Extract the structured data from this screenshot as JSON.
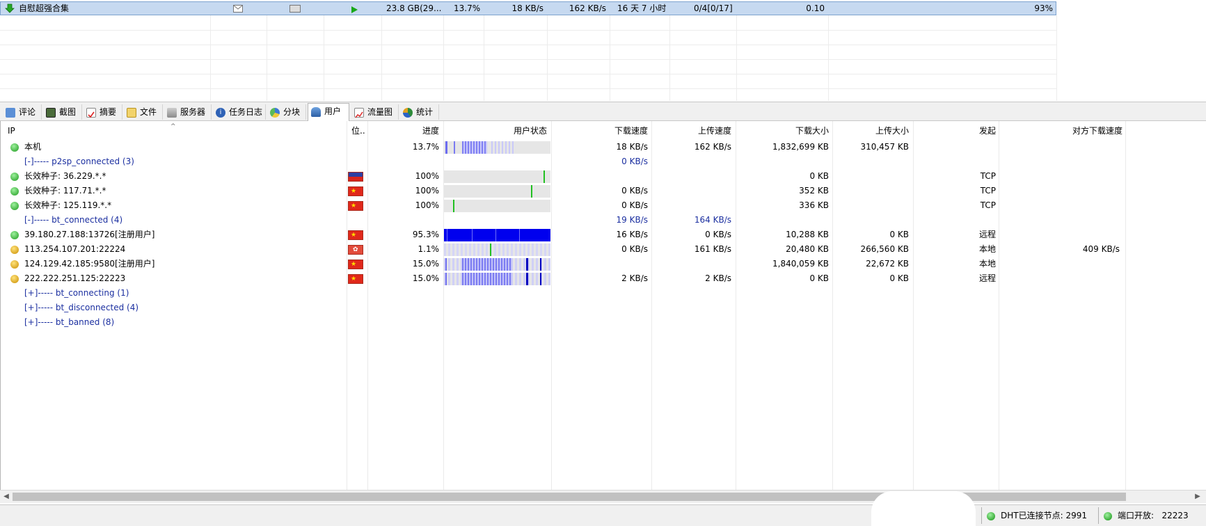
{
  "task": {
    "name": "自慰超强合集",
    "size": "23.8 GB(29...",
    "progress": "13.7%",
    "download_speed": "18 KB/s",
    "upload_speed": "162 KB/s",
    "remaining": "16 天 7 小时",
    "sources": "0/4[0/17]",
    "ratio": "0.10",
    "percent": "93%"
  },
  "tabs": [
    {
      "label": "评论",
      "icon": "comment-icon"
    },
    {
      "label": "截图",
      "icon": "screenshot-icon"
    },
    {
      "label": "摘要",
      "icon": "summary-icon"
    },
    {
      "label": "文件",
      "icon": "file-icon"
    },
    {
      "label": "服务器",
      "icon": "server-icon"
    },
    {
      "label": "任务日志",
      "icon": "info-icon"
    },
    {
      "label": "分块",
      "icon": "pie-icon"
    },
    {
      "label": "用户",
      "icon": "user-icon"
    },
    {
      "label": "流量图",
      "icon": "chart-icon"
    },
    {
      "label": "统计",
      "icon": "stats-icon"
    }
  ],
  "active_tab": "用户",
  "columns": {
    "ip": "IP",
    "location": "位..",
    "progress": "进度",
    "status": "用户状态",
    "download_speed": "下载速度",
    "upload_speed": "上传速度",
    "downloaded": "下载大小",
    "uploaded": "上传大小",
    "initiator": "发起",
    "peer_download_speed": "对方下载速度"
  },
  "rows": [
    {
      "type": "peer",
      "icon": "green-status-icon",
      "ip": "本机",
      "flag": "",
      "progress": "13.7%",
      "bar": "local",
      "dl": "18 KB/s",
      "ul": "162 KB/s",
      "dsize": "1,832,699 KB",
      "usize": "310,457 KB",
      "init": "",
      "pdl": ""
    },
    {
      "type": "group",
      "label": "[-]----- p2sp_connected (3)",
      "dl": "0 KB/s",
      "ul": ""
    },
    {
      "type": "peer",
      "icon": "green-status-icon",
      "ip": "长效种子: 36.229.*.*",
      "flag": "tw",
      "progress": "100%",
      "bar": "seed1",
      "dl": "",
      "ul": "",
      "dsize": "0 KB",
      "usize": "",
      "init": "TCP",
      "pdl": ""
    },
    {
      "type": "peer",
      "icon": "green-status-icon",
      "ip": "长效种子: 117.71.*.*",
      "flag": "cn",
      "progress": "100%",
      "bar": "seed2",
      "dl": "0 KB/s",
      "ul": "",
      "dsize": "352 KB",
      "usize": "",
      "init": "TCP",
      "pdl": ""
    },
    {
      "type": "peer",
      "icon": "green-status-icon",
      "ip": "长效种子: 125.119.*.*",
      "flag": "cn",
      "progress": "100%",
      "bar": "seed3",
      "dl": "0 KB/s",
      "ul": "",
      "dsize": "336 KB",
      "usize": "",
      "init": "TCP",
      "pdl": ""
    },
    {
      "type": "group",
      "label": "[-]----- bt_connected (4)",
      "dl": "19 KB/s",
      "ul": "164 KB/s"
    },
    {
      "type": "peer",
      "icon": "green-status-icon",
      "ip": "39.180.27.188:13726[注册用户]",
      "flag": "cn",
      "progress": "95.3%",
      "bar": "full",
      "dl": "16 KB/s",
      "ul": "0 KB/s",
      "dsize": "10,288 KB",
      "usize": "0 KB",
      "init": "远程",
      "pdl": ""
    },
    {
      "type": "peer",
      "icon": "yellow-status-icon",
      "ip": "113.254.107.201:22224",
      "flag": "hk",
      "progress": "1.1%",
      "bar": "small",
      "dl": "0 KB/s",
      "ul": "161 KB/s",
      "dsize": "20,480 KB",
      "usize": "266,560 KB",
      "init": "本地",
      "pdl": "409 KB/s"
    },
    {
      "type": "peer",
      "icon": "yellow-status-icon",
      "ip": "124.129.42.185:9580[注册用户]",
      "flag": "cn",
      "progress": "15.0%",
      "bar": "partial",
      "dl": "",
      "ul": "",
      "dsize": "1,840,059 KB",
      "usize": "22,672 KB",
      "init": "本地",
      "pdl": ""
    },
    {
      "type": "peer",
      "icon": "yellow-status-icon",
      "ip": "222.222.251.125:22223",
      "flag": "cn",
      "progress": "15.0%",
      "bar": "partial",
      "dl": "2 KB/s",
      "ul": "2 KB/s",
      "dsize": "0 KB",
      "usize": "0 KB",
      "init": "远程",
      "pdl": ""
    },
    {
      "type": "group",
      "label": "[+]----- bt_connecting (1)",
      "dl": "",
      "ul": ""
    },
    {
      "type": "group",
      "label": "[+]----- bt_disconnected (4)",
      "dl": "",
      "ul": ""
    },
    {
      "type": "group",
      "label": "[+]----- bt_banned (8)",
      "dl": "",
      "ul": ""
    }
  ],
  "statusbar": {
    "dht": "DHT已连接节点: 2991",
    "port": "端口开放:   22223"
  },
  "colors": {
    "selected_row": "#c6d9f0",
    "group_text": "#1b2fa0",
    "bar_blue": "#0000ee",
    "bar_light": "#9a9af0",
    "bar_green": "#22c022"
  }
}
